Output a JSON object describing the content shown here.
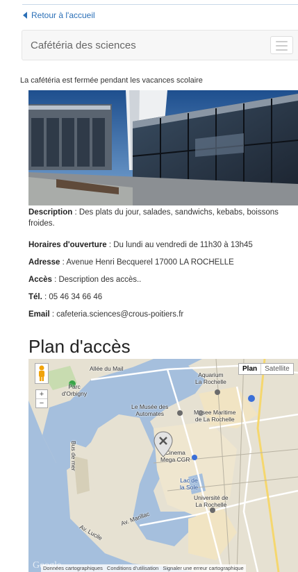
{
  "back_link": "Retour à l'accueil",
  "navbar": {
    "title": "Cafétéria des sciences"
  },
  "notice": "La cafétéria est fermée pendant les vacances scolaire",
  "info": {
    "description": {
      "label": "Description",
      "value": " : Des plats du jour, salades, sandwichs, kebabs, boissons froides."
    },
    "horaires": {
      "label": "Horaires d'ouverture",
      "value": " : Du lundi au vendredi de 11h30 à 13h45"
    },
    "adresse": {
      "label": "Adresse",
      "value": " : Avenue Henri Becquerel 17000 LA ROCHELLE"
    },
    "acces": {
      "label": "Accès",
      "value": " : Description des accès.."
    },
    "tel": {
      "label": "Tél.",
      "value": " : 05 46 34 66 46"
    },
    "email": {
      "label": "Email",
      "value": " : cafeteria.sciences@crous-poitiers.fr"
    }
  },
  "plan_title": "Plan d'accès",
  "map": {
    "type_plan": "Plan",
    "type_satellite": "Satellite",
    "zoom_in": "+",
    "zoom_out": "−",
    "labels": {
      "allee": "Allée du Mail",
      "parc": "Parc\nd'Orbigny",
      "aquarium": "Aquarium\nLa Rochelle",
      "musee_automates": "Le Musée des\nAutomates",
      "musee_maritime": "Musee Maritime\nde La Rochelle",
      "bus": "Bus de mer",
      "cinema": "Cinema\nMega CGR",
      "lac": "Lac de\nla Sole",
      "universite": "Université de\nLa Rochelle",
      "marillac": "Av. Marillac",
      "lucile": "Av. Lucile"
    },
    "google": "Google",
    "footer_data": "Données cartographiques",
    "footer_terms": "Conditions d'utilisation",
    "footer_report": "Signaler une erreur cartographique"
  },
  "colors": {
    "link": "#2a6fb7",
    "water": "#a5bfdd",
    "land": "#e8e4d8"
  }
}
